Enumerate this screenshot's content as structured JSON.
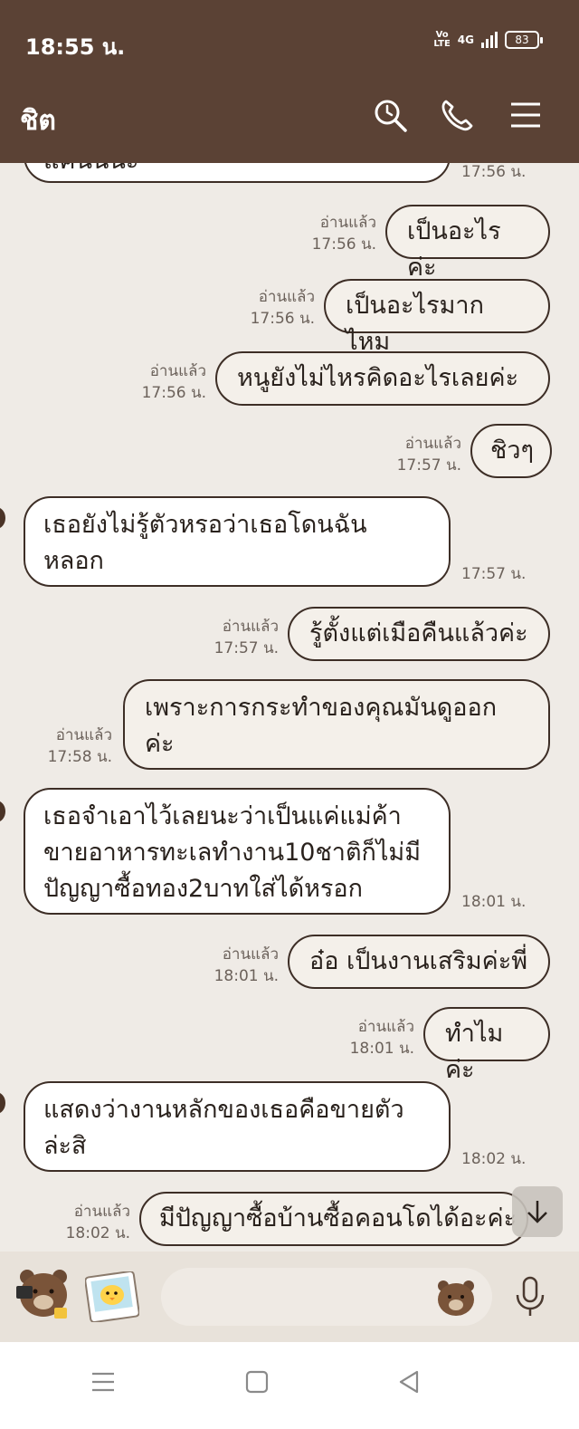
{
  "status_bar": {
    "time": "18:55 น.",
    "volte_top": "Vo",
    "volte_bottom": "LTE",
    "network": "4G",
    "battery": "83"
  },
  "header": {
    "title": "ชิต",
    "icons": [
      "search-icon",
      "phone-icon",
      "menu-icon"
    ]
  },
  "messages": [
    {
      "id": 0,
      "dir": "in",
      "text": "แค่นั้นนะ",
      "time": "17:56 น."
    },
    {
      "id": 1,
      "dir": "out",
      "text": "เป็นอะไรค่ะ",
      "read": "อ่านแล้ว",
      "time": "17:56 น."
    },
    {
      "id": 2,
      "dir": "out",
      "text": "เป็นอะไรมากไหม",
      "read": "อ่านแล้ว",
      "time": "17:56 น."
    },
    {
      "id": 3,
      "dir": "out",
      "text": "หนูยังไม่ไหรคิดอะไรเลยค่ะ",
      "read": "อ่านแล้ว",
      "time": "17:56 น."
    },
    {
      "id": 4,
      "dir": "out",
      "text": "ชิวๆ",
      "read": "อ่านแล้ว",
      "time": "17:57 น."
    },
    {
      "id": 5,
      "dir": "in",
      "text_lines": [
        "เธอยังไม่รู้ตัวหรอว่าเธอโดนฉัน",
        "หลอก"
      ],
      "time": "17:57 น."
    },
    {
      "id": 6,
      "dir": "out",
      "text": "รู้ตั้งแต่เมือคืนแล้วค่ะ",
      "read": "อ่านแล้ว",
      "time": "17:57 น."
    },
    {
      "id": 7,
      "dir": "out",
      "text_lines": [
        "เพราะการกระทำของคุณมันดูออก",
        "ค่ะ"
      ],
      "read": "อ่านแล้ว",
      "time": "17:58 น."
    },
    {
      "id": 8,
      "dir": "in",
      "text_lines": [
        "เธอจำเอาไว้เลยนะว่าเป็นแค่แม่ค้า",
        "ขายอาหารทะเลทำงาน10ชาติก็ไม่มี",
        "ปัญญาซื้อทอง2บาทใส่ได้หรอก"
      ],
      "time": "18:01 น."
    },
    {
      "id": 9,
      "dir": "out",
      "text": "อ๋อ เป็นงานเสริมค่ะพี่",
      "read": "อ่านแล้ว",
      "time": "18:01 น."
    },
    {
      "id": 10,
      "dir": "out",
      "text": "ทำไมค่ะ",
      "read": "อ่านแล้ว",
      "time": "18:01 น."
    },
    {
      "id": 11,
      "dir": "in",
      "text_lines": [
        "แสดงว่างานหลักของเธอคือขายตัว",
        "ล่ะสิ"
      ],
      "time": "18:02 น."
    },
    {
      "id": 12,
      "dir": "out",
      "text": "มีปัญญาซื้อบ้านซื้อคอนโดได้อะค่ะ",
      "read": "อ่านแล้ว",
      "time": "18:02 น."
    }
  ],
  "input_bar": {
    "placeholder": "",
    "icons": [
      "bear-sticker-icon",
      "chick-photo-icon",
      "bear-emoji-icon",
      "microphone-icon"
    ]
  },
  "nav_bar": {
    "icons": [
      "recent-apps-icon",
      "home-icon",
      "back-icon"
    ]
  },
  "colors": {
    "header": "#5b4235",
    "chat_bg": "#efebe6",
    "bubble_border": "#3d2e26"
  }
}
